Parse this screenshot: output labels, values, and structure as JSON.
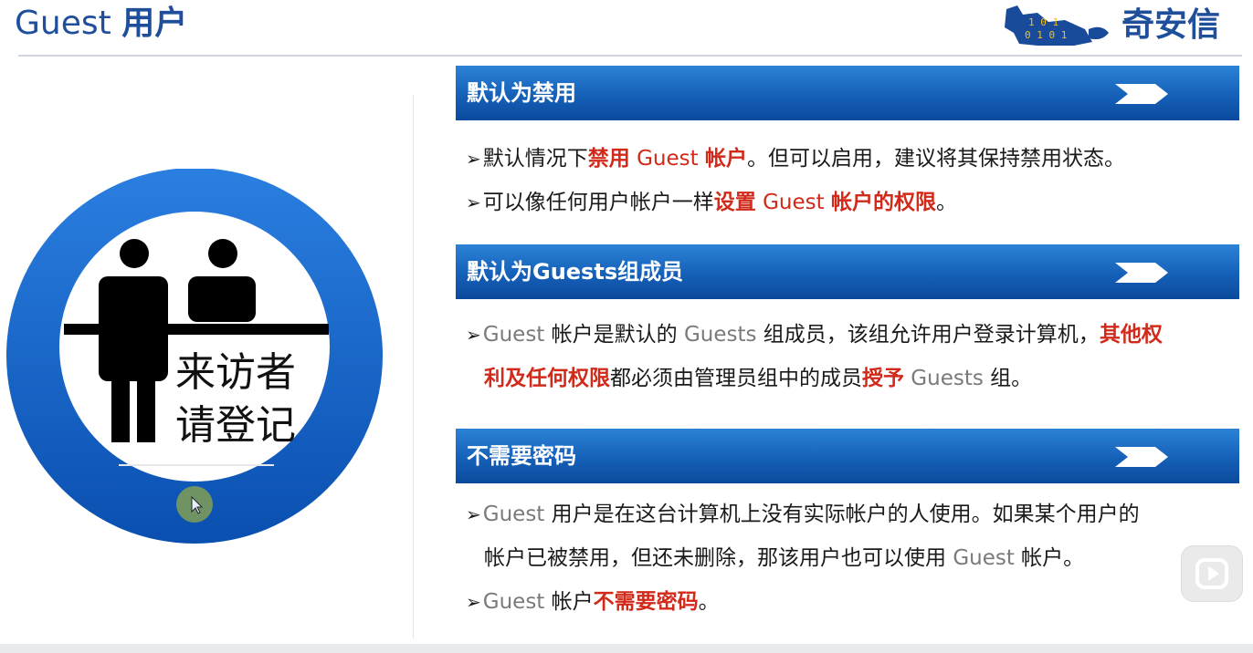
{
  "slide": {
    "title_en": "Guest",
    "title_cn": "用户",
    "logo_text": "奇安信"
  },
  "illustration": {
    "sign_line1": "来访者",
    "sign_line2": "请登记"
  },
  "sections": [
    {
      "header": "默认为禁用",
      "bullets": [
        {
          "parts": [
            {
              "t": "默认情况下",
              "style": "normal"
            },
            {
              "t": "禁用",
              "style": "red"
            },
            {
              "t": " Guest ",
              "style": "red-light"
            },
            {
              "t": "帐户",
              "style": "red"
            },
            {
              "t": "。但可以启用，建议将其保持禁用状态。",
              "style": "normal"
            }
          ]
        },
        {
          "parts": [
            {
              "t": "可以像任何用户帐户一样",
              "style": "normal"
            },
            {
              "t": "设置",
              "style": "red"
            },
            {
              "t": " Guest ",
              "style": "red-light"
            },
            {
              "t": "帐户的权限",
              "style": "red"
            },
            {
              "t": "。",
              "style": "normal"
            }
          ]
        }
      ]
    },
    {
      "header": "默认为Guests组成员",
      "bullets": [
        {
          "parts": [
            {
              "t": "Guest",
              "style": "gray"
            },
            {
              "t": " 帐户是默认的 ",
              "style": "normal"
            },
            {
              "t": "Guests",
              "style": "gray"
            },
            {
              "t": " 组成员，该组允许用户登录计算机，",
              "style": "normal"
            },
            {
              "t": "其他权",
              "style": "red"
            }
          ],
          "cont": [
            {
              "t": "利及任何权限",
              "style": "red"
            },
            {
              "t": "都必须由管理员组中的成员",
              "style": "normal"
            },
            {
              "t": "授予",
              "style": "red"
            },
            {
              "t": " Guests ",
              "style": "gray"
            },
            {
              "t": "组。",
              "style": "normal"
            }
          ]
        }
      ]
    },
    {
      "header": "不需要密码",
      "bullets": [
        {
          "parts": [
            {
              "t": "Guest",
              "style": "gray"
            },
            {
              "t": " 用户是在这台计算机上没有实际帐户的人使用。如果某个用户的",
              "style": "normal"
            }
          ],
          "cont": [
            {
              "t": "帐户已被禁用，但还未删除，那该用户也可以使用 ",
              "style": "normal"
            },
            {
              "t": "Guest",
              "style": "gray"
            },
            {
              "t": " 帐户。",
              "style": "normal"
            }
          ]
        },
        {
          "parts": [
            {
              "t": "Guest",
              "style": "gray"
            },
            {
              "t": " 帐户",
              "style": "normal"
            },
            {
              "t": "不需要密码",
              "style": "red"
            },
            {
              "t": "。",
              "style": "normal"
            }
          ]
        }
      ]
    }
  ],
  "bullet_symbol": "➢",
  "icons": [
    "arrow-chevron-icon",
    "play-icon",
    "mouse-cursor-icon",
    "visitor-people-icon"
  ],
  "colors": {
    "title": "#1f4e9a",
    "banner": "#1560b8",
    "emphasis": "#d22a1a",
    "ring": "#0d5fc4"
  }
}
